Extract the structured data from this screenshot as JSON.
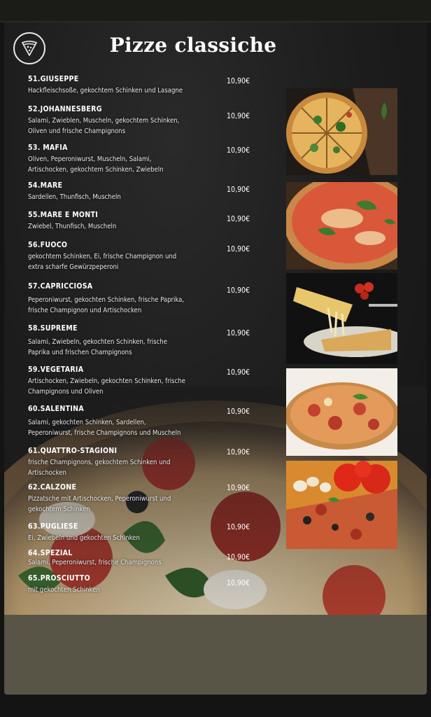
{
  "menu": {
    "title": "Pizze classiche",
    "items": [
      {
        "name": "51.GIUSEPPE",
        "desc": "Hackfleischsoße, gekochtem Schinken und Lasagne",
        "price": "10,90€"
      },
      {
        "name": "52.JOHANNESBERG",
        "desc": "Salami, Zwieblen, Muscheln, gekochtem Schinken, Oliven und frische Champignons",
        "price": "10,90€"
      },
      {
        "name": "53. MAFIA",
        "desc": "Oliven, Peperoniwurst, Muscheln, Salami, Artischocken, gekochtem Schinken, Zwiebeln",
        "price": "10,90€"
      },
      {
        "name": "54.MARE",
        "desc": "Sardellen, Thunfisch, Muscheln",
        "price": "10,90€"
      },
      {
        "name": "55.MARE E MONTI",
        "desc": "Zwiebel, Thunfisch, Muscheln",
        "price": "10,90€"
      },
      {
        "name": "56.FUOCO",
        "desc": "gekochtem Schinken, Ei, frische Champignon und extra scharfe Gewürzpeperoni",
        "price": "10,90€"
      },
      {
        "name": "57.CAPRICCIOSA",
        "desc": "Peperoniwurst, gekochten Schinken, frische Paprika, frische Champignon und Artischocken",
        "price": "10,90€"
      },
      {
        "name": "58.SUPREME",
        "desc": "Salami, Zwiebeln, gekochten Schinken, frische Paprika und frischen Champignons",
        "price": "10,90€"
      },
      {
        "name": "59.VEGETARIA",
        "desc": "Artischocken, Zwiebeln, gekochten Schinken, frische Champignons und Oliven",
        "price": "10,90€"
      },
      {
        "name": "60.SALENTINA",
        "desc": "Salami, gekochten Schinken, Sardellen, Peperoniwurst, frische Champignons und Muscheln",
        "price": "10,90€"
      },
      {
        "name": "61.QUATTRO-STAGIONI",
        "desc": "frische Champignons, gekochtem Schinken und Artischocken",
        "price": "10,90€"
      },
      {
        "name": "62.CALZONE",
        "desc": "Pizzatsche mit Artischocken, Peperoniwurst und gekochtem Schinken",
        "price": "10,90€"
      },
      {
        "name": "63.PUGLIESE",
        "desc": "Ei, Zwiebeln und gekochten Schinken",
        "price": "10,90€"
      },
      {
        "name": "64.SPEZIAL",
        "desc": "Salami, Peperoniwurst, frische Champignons",
        "price": "10,90€"
      },
      {
        "name": "65.PROSCIUTTO",
        "desc": "mit gekochten Schinken",
        "price": "10,90€"
      }
    ]
  },
  "icons": {
    "logo": "pizza-slice-icon"
  },
  "colors": {
    "background": "#1c1c1c",
    "text": "#ffffff",
    "card_bottom": "#595546"
  }
}
